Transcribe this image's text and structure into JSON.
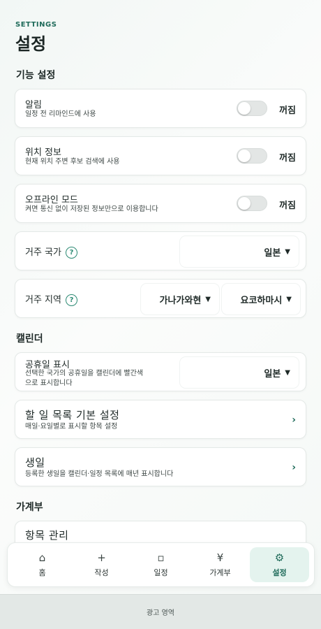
{
  "header": {
    "eyebrow": "SETTINGS",
    "title": "설정"
  },
  "sections": {
    "features": "기능 설정",
    "calendar": "캘린더",
    "ledger": "가계부"
  },
  "notifications": {
    "label": "알림",
    "desc": "일정 전 리마인드에 사용",
    "state": "꺼짐"
  },
  "location": {
    "label": "위치 정보",
    "desc": "현재 위치 주변 후보 검색에 사용",
    "state": "꺼짐"
  },
  "offline": {
    "label": "오프라인 모드",
    "desc": "켜면 통신 없이 저장된 정보만으로 이용합니다",
    "state": "꺼짐"
  },
  "country": {
    "label": "거주 국가",
    "help": "?",
    "value": "일본"
  },
  "region": {
    "label": "거주 지역",
    "help": "?",
    "prefecture": "가나가와현",
    "city": "요코하마시"
  },
  "holidays": {
    "label": "공휴일 표시",
    "desc_line1": "선택한 국가의 공휴일을 캘린더에 빨간색",
    "desc_line2": "으로 표시합니다",
    "value": "일본"
  },
  "todo_defaults": {
    "label": "할 일 목록 기본 설정",
    "desc": "매일·요일별로 표시할 항목 설정"
  },
  "birthdays": {
    "label": "생일",
    "desc": "등록한 생일을 캘린더·일정 목록에 매년 표시합니다"
  },
  "ledger_items": {
    "label": "항목 관리"
  },
  "nav": {
    "items": [
      {
        "label": "홈",
        "icon": "⌂"
      },
      {
        "label": "작성",
        "icon": "+"
      },
      {
        "label": "일정",
        "icon": "▫"
      },
      {
        "label": "가계부",
        "icon": "¥"
      },
      {
        "label": "설정",
        "icon": "⚙"
      }
    ]
  },
  "ad": {
    "label": "광고 영역"
  },
  "colors": {
    "accent": "#1f6b5a",
    "active_bg": "#e4f3ee"
  }
}
